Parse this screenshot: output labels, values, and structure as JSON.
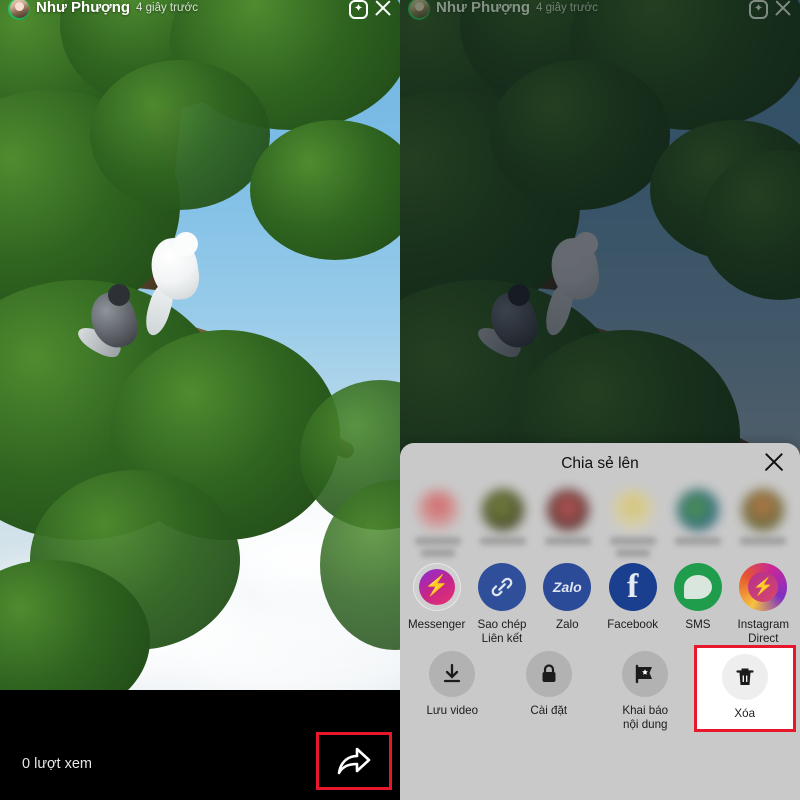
{
  "story": {
    "username": "Như Phượng",
    "timestamp": "4 giây trước",
    "views_label": "0 lượt xem",
    "effects_icon": "sparkle-square-icon",
    "close_icon": "close-icon",
    "share_icon": "share-arrow-icon",
    "highlight_color": "#e8172b"
  },
  "share_sheet": {
    "title": "Chia sẻ lên",
    "close_label": "✕",
    "apps": [
      {
        "label": "Messenger",
        "icon": "messenger-icon"
      },
      {
        "label": "Sao chép\nLiên kết",
        "icon": "link-icon"
      },
      {
        "label": "Zalo",
        "icon": "zalo-icon"
      },
      {
        "label": "Facebook",
        "icon": "facebook-icon"
      },
      {
        "label": "SMS",
        "icon": "sms-icon"
      },
      {
        "label": "Instagram\nDirect",
        "icon": "instagram-direct-icon"
      }
    ],
    "actions": [
      {
        "label": "Lưu video",
        "icon": "download-icon",
        "highlighted": false
      },
      {
        "label": "Cài đặt",
        "icon": "lock-icon",
        "highlighted": false
      },
      {
        "label": "Khai báo\nnội dung",
        "icon": "report-icon",
        "highlighted": false
      },
      {
        "label": "Xóa",
        "icon": "trash-icon",
        "highlighted": true
      }
    ],
    "contacts_blurred": true,
    "contacts_count": 6
  }
}
